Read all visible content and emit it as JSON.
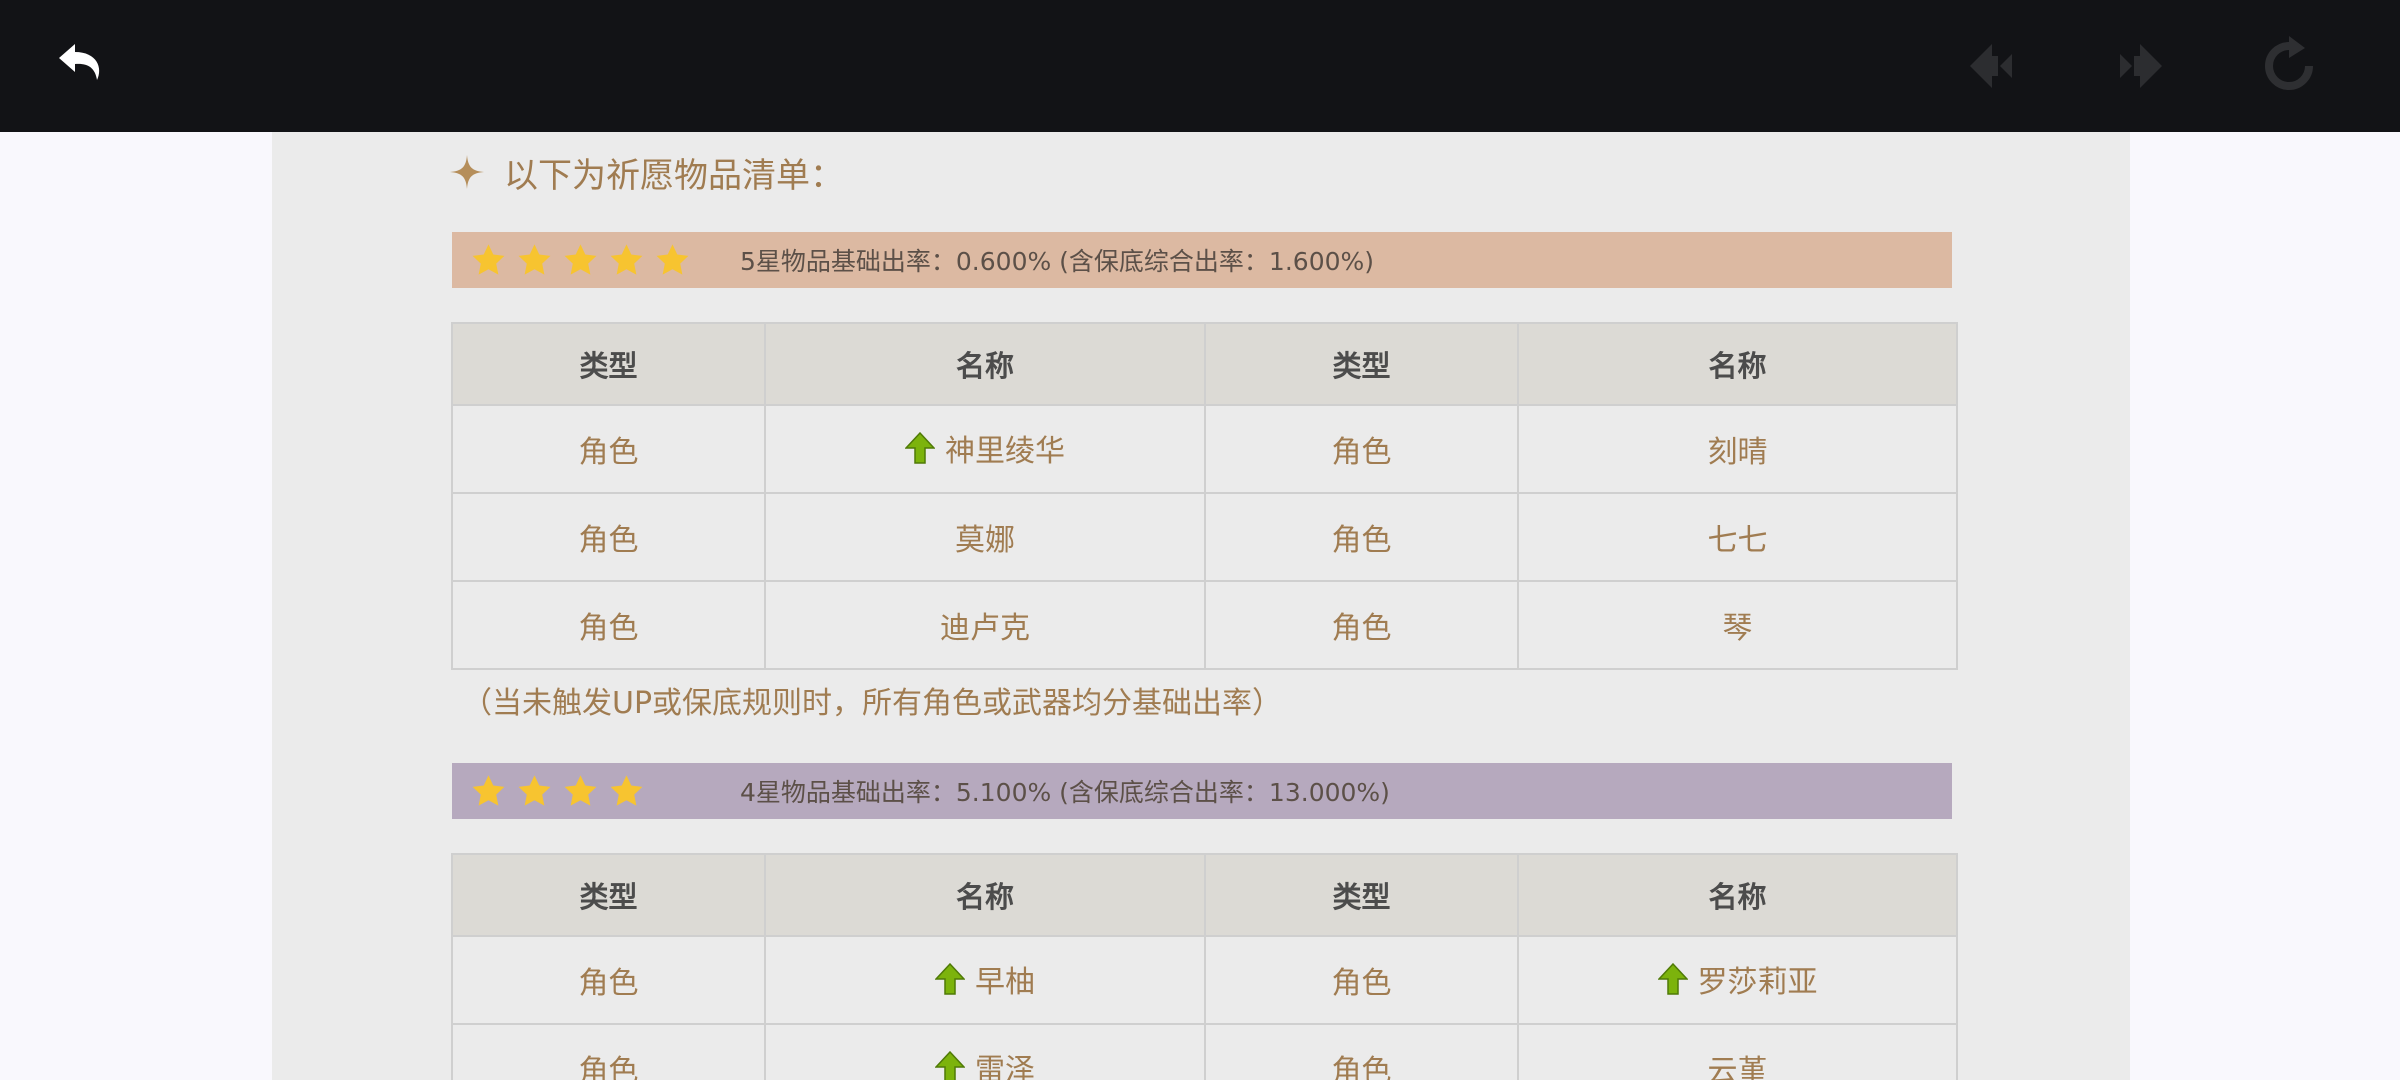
{
  "colors": {
    "topbar_bg": "#121316",
    "panel_bg": "#ebebeb",
    "accent_text": "#a07c51",
    "five_star_bar": "#dcb9a2",
    "four_star_bar": "#b6a9be",
    "star": "#f7c430",
    "up_arrow": "#7cb30c"
  },
  "toolbar": {
    "back_icon": "undo-arrow-icon",
    "prev_icon": "diamond-arrow-left-icon",
    "next_icon": "diamond-arrow-right-icon",
    "refresh_icon": "refresh-icon"
  },
  "section": {
    "title": "以下为祈愿物品清单："
  },
  "five_star": {
    "stars": 5,
    "rate_text": "5星物品基础出率：0.600% (含保底综合出率：1.600%)",
    "headers": [
      "类型",
      "名称",
      "类型",
      "名称"
    ],
    "rows": [
      [
        {
          "text": "角色",
          "up": false
        },
        {
          "text": "神里绫华",
          "up": true
        },
        {
          "text": "角色",
          "up": false
        },
        {
          "text": "刻晴",
          "up": false
        }
      ],
      [
        {
          "text": "角色",
          "up": false
        },
        {
          "text": "莫娜",
          "up": false
        },
        {
          "text": "角色",
          "up": false
        },
        {
          "text": "七七",
          "up": false
        }
      ],
      [
        {
          "text": "角色",
          "up": false
        },
        {
          "text": "迪卢克",
          "up": false
        },
        {
          "text": "角色",
          "up": false
        },
        {
          "text": "琴",
          "up": false
        }
      ]
    ]
  },
  "note": "（当未触发UP或保底规则时，所有角色或武器均分基础出率）",
  "four_star": {
    "stars": 4,
    "rate_text": "4星物品基础出率：5.100% (含保底综合出率：13.000%)",
    "headers": [
      "类型",
      "名称",
      "类型",
      "名称"
    ],
    "rows": [
      [
        {
          "text": "角色",
          "up": false
        },
        {
          "text": "早柚",
          "up": true
        },
        {
          "text": "角色",
          "up": false
        },
        {
          "text": "罗莎莉亚",
          "up": true
        }
      ],
      [
        {
          "text": "角色",
          "up": false
        },
        {
          "text": "雷泽",
          "up": true
        },
        {
          "text": "角色",
          "up": false
        },
        {
          "text": "云堇",
          "up": false
        }
      ]
    ]
  }
}
